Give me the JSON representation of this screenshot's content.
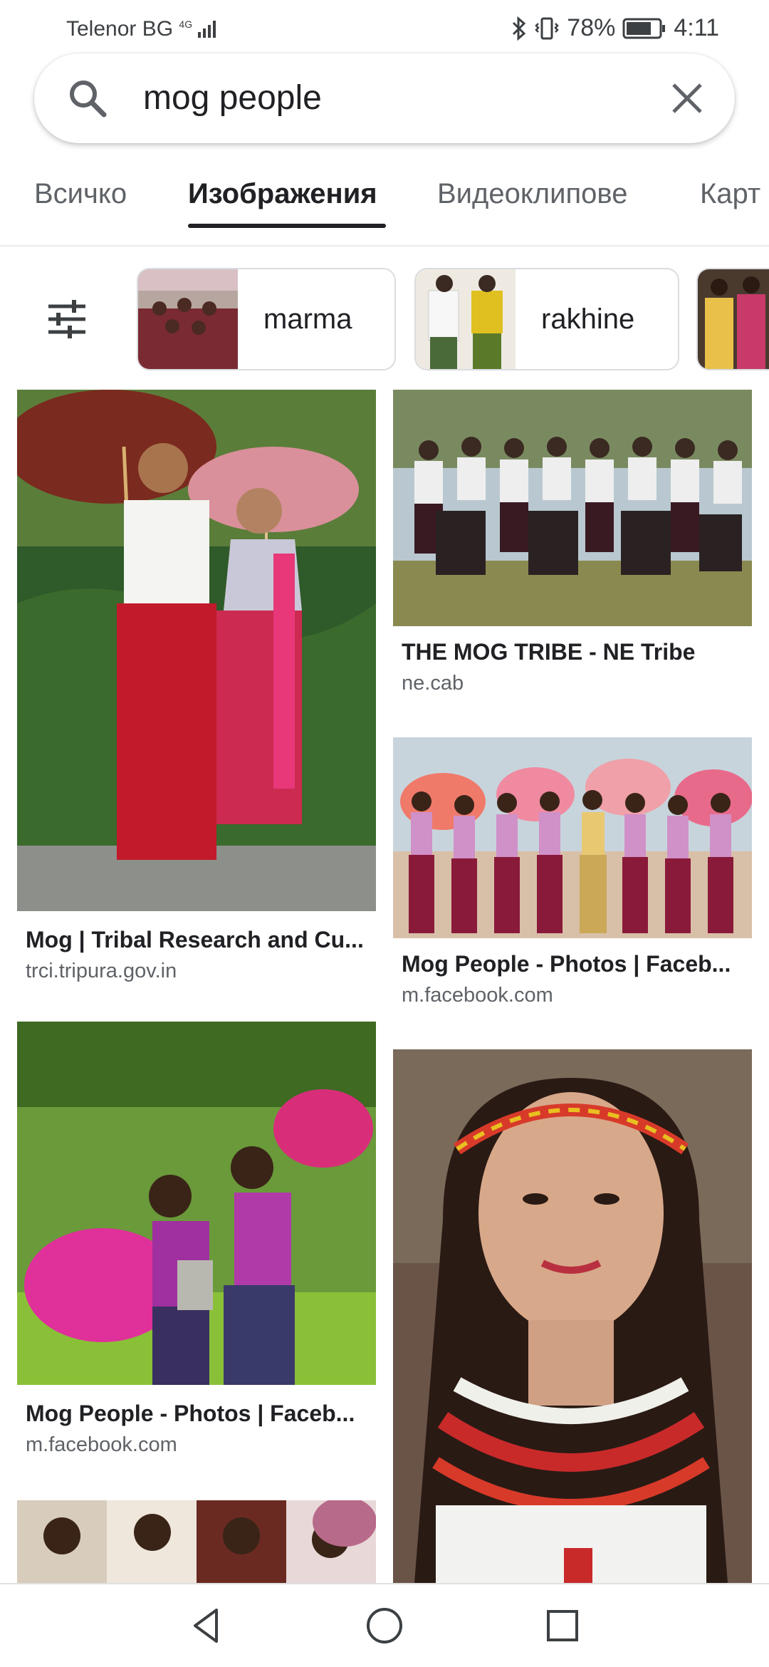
{
  "status_bar": {
    "carrier": "Telenor BG",
    "network": "4G",
    "battery": "78%",
    "time": "4:11"
  },
  "search": {
    "query": "mog people"
  },
  "tabs": [
    {
      "label": "Всичко",
      "active": false
    },
    {
      "label": "Изображения",
      "active": true
    },
    {
      "label": "Видеоклипове",
      "active": false
    },
    {
      "label": "Карт",
      "active": false
    }
  ],
  "chips": [
    {
      "label": "marma"
    },
    {
      "label": "rakhine"
    },
    {
      "label": ""
    }
  ],
  "results": {
    "left": [
      {
        "title": "Mog | Tribal Research and Cu...",
        "domain": "trci.tripura.gov.in"
      },
      {
        "title": "Mog People - Photos | Faceb...",
        "domain": "m.facebook.com"
      }
    ],
    "right": [
      {
        "title": "THE MOG TRIBE - NE Tribe",
        "domain": "ne.cab"
      },
      {
        "title": "Mog People - Photos | Faceb...",
        "domain": "m.facebook.com"
      }
    ]
  },
  "colors": {
    "accent": "#202124",
    "secondary_text": "#5f6368",
    "divider": "#dadce0"
  },
  "icons": [
    "search-icon",
    "close-icon",
    "filter-icon",
    "bluetooth-icon",
    "vibrate-icon",
    "battery-icon",
    "signal-icon",
    "back-icon",
    "home-icon",
    "recents-icon"
  ]
}
